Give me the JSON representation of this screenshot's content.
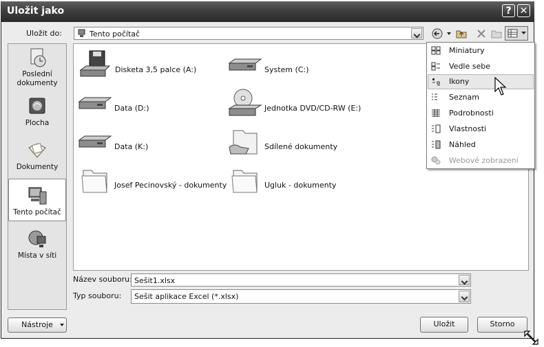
{
  "window": {
    "title": "Uložit jako",
    "help_button": "?",
    "close_button": "✕"
  },
  "toolbar": {
    "save_in_label": "Uložit do:",
    "location_value": "Tento počítač"
  },
  "places": [
    {
      "label": "Poslední dokumenty",
      "icon": "recent-documents-icon"
    },
    {
      "label": "Plocha",
      "icon": "desktop-icon"
    },
    {
      "label": "Dokumenty",
      "icon": "documents-icon"
    },
    {
      "label": "Tento počítač",
      "icon": "computer-icon",
      "selected": true
    },
    {
      "label": "Místa v síti",
      "icon": "network-icon"
    }
  ],
  "files": [
    {
      "label": "Disketa 3,5 palce (A:)",
      "icon": "floppy-drive-icon"
    },
    {
      "label": "System (C:)",
      "icon": "hard-drive-icon"
    },
    {
      "label": "Data (D:)",
      "icon": "hard-drive-icon"
    },
    {
      "label": "Jednotka DVD/CD-RW (E:)",
      "icon": "dvd-drive-icon"
    },
    {
      "label": "Data (K:)",
      "icon": "hard-drive-icon"
    },
    {
      "label": "Sdílené dokumenty",
      "icon": "shared-folder-icon"
    },
    {
      "label": "Josef Pecinovský - dokumenty",
      "icon": "folder-icon"
    },
    {
      "label": "Ugluk - dokumenty",
      "icon": "folder-icon"
    }
  ],
  "view_menu": [
    {
      "label": "Miniatury",
      "icon": "thumbnails-view-icon"
    },
    {
      "label": "Vedle sebe",
      "icon": "tiles-view-icon"
    },
    {
      "label": "Ikony",
      "icon": "icons-view-icon",
      "highlighted": true
    },
    {
      "label": "Seznam",
      "icon": "list-view-icon"
    },
    {
      "label": "Podrobnosti",
      "icon": "details-view-icon"
    },
    {
      "label": "Vlastnosti",
      "icon": "properties-view-icon"
    },
    {
      "label": "Náhled",
      "icon": "preview-view-icon"
    },
    {
      "label": "Webové zobrazení",
      "icon": "web-view-icon",
      "disabled": true
    }
  ],
  "filename": {
    "label": "Název souboru:",
    "value": "Sešit1.xlsx"
  },
  "filetype": {
    "label": "Typ souboru:",
    "value": "Sešit aplikace Excel (*.xlsx)"
  },
  "buttons": {
    "tools": "Nástroje",
    "save": "Uložit",
    "cancel": "Storno"
  }
}
